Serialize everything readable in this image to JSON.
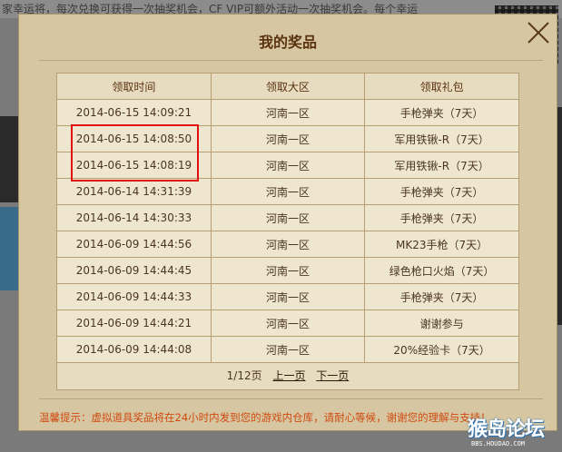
{
  "background": {
    "top_text": "家幸运将，每次兑换可获得一次抽奖机会，CF VIP可额外活动一次抽奖机会。每个幸运"
  },
  "dialog": {
    "title": "我的奖品",
    "close_icon": "close-x-icon",
    "columns": [
      "领取时间",
      "领取大区",
      "领取礼包"
    ],
    "rows": [
      {
        "time": "2014-06-15 14:09:21",
        "region": "河南一区",
        "gift": "手枪弹夹（7天）"
      },
      {
        "time": "2014-06-15 14:08:50",
        "region": "河南一区",
        "gift": "军用铁锹-R（7天）"
      },
      {
        "time": "2014-06-15 14:08:19",
        "region": "河南一区",
        "gift": "军用铁锹-R（7天）"
      },
      {
        "time": "2014-06-14 14:31:39",
        "region": "河南一区",
        "gift": "手枪弹夹（7天）"
      },
      {
        "time": "2014-06-14 14:30:33",
        "region": "河南一区",
        "gift": "手枪弹夹（7天）"
      },
      {
        "time": "2014-06-09 14:44:56",
        "region": "河南一区",
        "gift": "MK23手枪（7天）"
      },
      {
        "time": "2014-06-09 14:44:45",
        "region": "河南一区",
        "gift": "绿色枪口火焰（7天）"
      },
      {
        "time": "2014-06-09 14:44:33",
        "region": "河南一区",
        "gift": "手枪弹夹（7天）"
      },
      {
        "time": "2014-06-09 14:44:21",
        "region": "河南一区",
        "gift": "谢谢参与"
      },
      {
        "time": "2014-06-09 14:44:08",
        "region": "河南一区",
        "gift": "20%经验卡（7天）"
      }
    ],
    "pager": {
      "page_info": "1/12页",
      "prev_label": "上一页",
      "next_label": "下一页"
    },
    "tip": "温馨提示：虚拟道具奖品将在24小时内发到您的游戏内仓库，请耐心等候，谢谢您的理解与支持！",
    "highlight_color": "#e01010"
  },
  "watermark": {
    "main": "猴岛论坛",
    "sub": "BBS.HOUDAO.COM"
  }
}
